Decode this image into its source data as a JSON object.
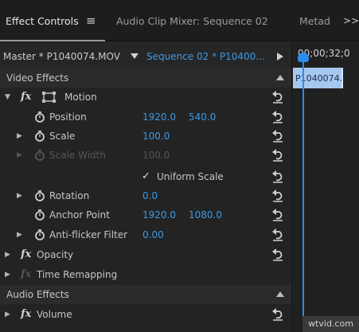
{
  "tabs": {
    "effect_controls": "Effect Controls",
    "menu_glyph": "≡",
    "audio_clip_mixer": "Audio Clip Mixer: Sequence 02",
    "metadata": "Metad",
    "overflow": ">>"
  },
  "source_bar": {
    "master": "Master * P1040074.MOV",
    "sequence": "Sequence 02 * P10400...",
    "timecode": "00;00;32;0",
    "clip_name": "P1040074."
  },
  "sections": {
    "video_effects": "Video Effects",
    "audio_effects": "Audio Effects"
  },
  "motion": {
    "label": "Motion",
    "position": {
      "label": "Position",
      "x": "1920.0",
      "y": "540.0"
    },
    "scale": {
      "label": "Scale",
      "value": "100.0"
    },
    "scale_width": {
      "label": "Scale Width",
      "value": "100.0"
    },
    "uniform_scale": {
      "label": "Uniform Scale",
      "check": "✓"
    },
    "rotation": {
      "label": "Rotation",
      "value": "0.0"
    },
    "anchor_point": {
      "label": "Anchor Point",
      "x": "1920.0",
      "y": "1080.0"
    },
    "anti_flicker": {
      "label": "Anti-flicker Filter",
      "value": "0.00"
    }
  },
  "fx_glyph": "fx",
  "opacity": {
    "label": "Opacity"
  },
  "time_remapping": {
    "label": "Time Remapping"
  },
  "volume": {
    "label": "Volume"
  },
  "watermark": "wtvid.com",
  "colors": {
    "panel_bg": "#232323",
    "value_blue": "#3b9ae8",
    "playhead_blue": "#2d8ceb",
    "clip_bar": "#a6c7ee"
  }
}
